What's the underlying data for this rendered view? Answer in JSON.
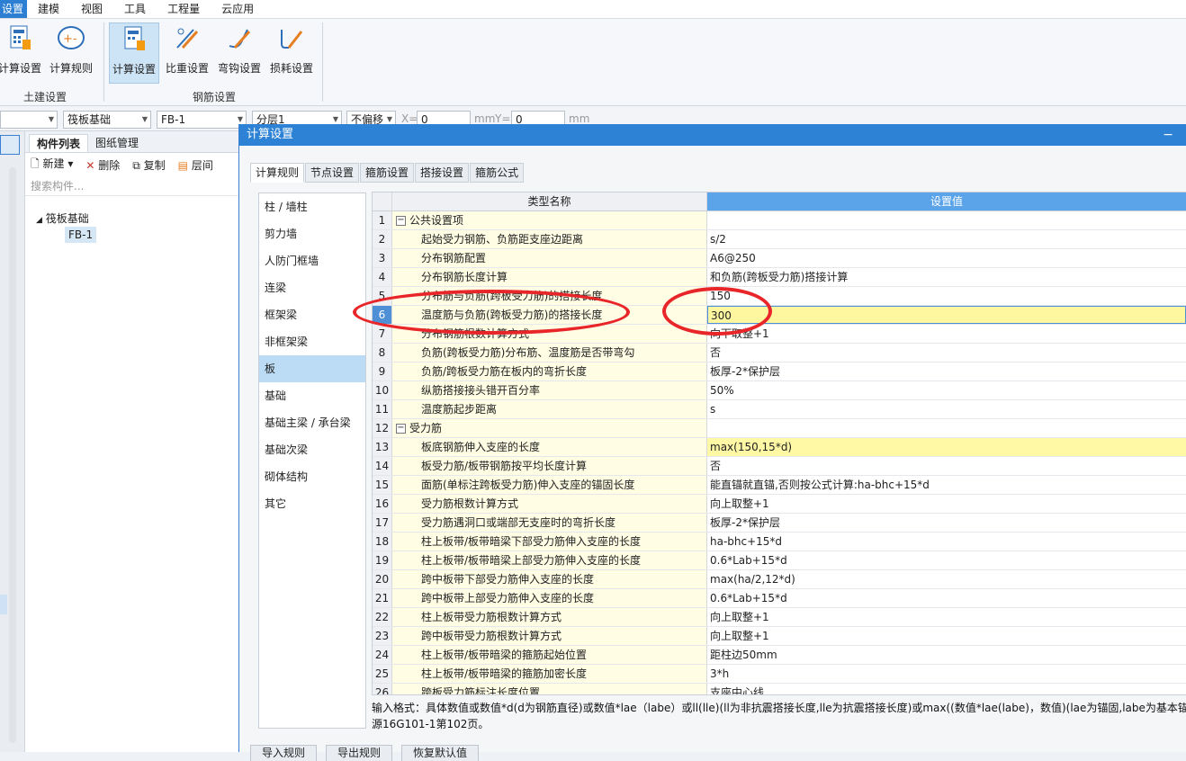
{
  "menubar": {
    "items": [
      "设置",
      "建模",
      "视图",
      "工具",
      "工程量",
      "云应用"
    ]
  },
  "ribbon": {
    "buttons": [
      "计算设置",
      "计算规则",
      "计算设置",
      "比重设置",
      "弯钩设置",
      "损耗设置"
    ],
    "groups": [
      "土建设置",
      "钢筋设置"
    ]
  },
  "toolbar2": {
    "combo_type": "筏板基础",
    "combo_name": "FB-1",
    "combo_layer": "分层1",
    "combo_offset": "不偏移",
    "x_label": "X=",
    "x_value": "0",
    "y_label": "Y=",
    "y_value": "0",
    "unit": "mm"
  },
  "left_panel": {
    "tabs": [
      "构件列表",
      "图纸管理"
    ],
    "tools": [
      "新建",
      "删除",
      "复制",
      "层间"
    ],
    "search_placeholder": "搜索构件...",
    "tree_root": "筏板基础",
    "tree_child": "FB-1"
  },
  "dialog": {
    "title": "计算设置",
    "tabs": [
      "计算规则",
      "节点设置",
      "箍筋设置",
      "搭接设置",
      "箍筋公式"
    ],
    "categories": [
      "柱 / 墙柱",
      "剪力墙",
      "人防门框墙",
      "连梁",
      "框架梁",
      "非框架梁",
      "板",
      "基础",
      "基础主梁 / 承台梁",
      "基础次梁",
      "砌体结构",
      "其它"
    ],
    "grid_headers": [
      "类型名称",
      "设置值"
    ],
    "rows": [
      {
        "n": "1",
        "name": "公共设置项",
        "value": "",
        "group": true
      },
      {
        "n": "2",
        "name": "起始受力钢筋、负筋距支座边距离",
        "value": "s/2"
      },
      {
        "n": "3",
        "name": "分布钢筋配置",
        "value": "A6@250"
      },
      {
        "n": "4",
        "name": "分布钢筋长度计算",
        "value": "和负筋(跨板受力筋)搭接计算"
      },
      {
        "n": "5",
        "name": "分布筋与负筋(跨板受力筋)的搭接长度",
        "value": "150"
      },
      {
        "n": "6",
        "name": "温度筋与负筋(跨板受力筋)的搭接长度",
        "value": "300",
        "current": true
      },
      {
        "n": "7",
        "name": "分布钢筋根数计算方式",
        "value": "向下取整+1"
      },
      {
        "n": "8",
        "name": "负筋(跨板受力筋)分布筋、温度筋是否带弯勾",
        "value": "否"
      },
      {
        "n": "9",
        "name": "负筋/跨板受力筋在板内的弯折长度",
        "value": "板厚-2*保护层"
      },
      {
        "n": "10",
        "name": "纵筋搭接接头错开百分率",
        "value": "50%"
      },
      {
        "n": "11",
        "name": "温度筋起步距离",
        "value": "s"
      },
      {
        "n": "12",
        "name": "受力筋",
        "value": "",
        "group": true
      },
      {
        "n": "13",
        "name": "板底钢筋伸入支座的长度",
        "value": "max(150,15*d)",
        "hl": true
      },
      {
        "n": "14",
        "name": "板受力筋/板带钢筋按平均长度计算",
        "value": "否"
      },
      {
        "n": "15",
        "name": "面筋(单标注跨板受力筋)伸入支座的锚固长度",
        "value": "能直锚就直锚,否则按公式计算:ha-bhc+15*d"
      },
      {
        "n": "16",
        "name": "受力筋根数计算方式",
        "value": "向上取整+1"
      },
      {
        "n": "17",
        "name": "受力筋遇洞口或端部无支座时的弯折长度",
        "value": "板厚-2*保护层"
      },
      {
        "n": "18",
        "name": "柱上板带/板带暗梁下部受力筋伸入支座的长度",
        "value": "ha-bhc+15*d"
      },
      {
        "n": "19",
        "name": "柱上板带/板带暗梁上部受力筋伸入支座的长度",
        "value": "0.6*Lab+15*d"
      },
      {
        "n": "20",
        "name": "跨中板带下部受力筋伸入支座的长度",
        "value": "max(ha/2,12*d)"
      },
      {
        "n": "21",
        "name": "跨中板带上部受力筋伸入支座的长度",
        "value": "0.6*Lab+15*d"
      },
      {
        "n": "22",
        "name": "柱上板带受力筋根数计算方式",
        "value": "向上取整+1"
      },
      {
        "n": "23",
        "name": "跨中板带受力筋根数计算方式",
        "value": "向上取整+1"
      },
      {
        "n": "24",
        "name": "柱上板带/板带暗梁的箍筋起始位置",
        "value": "距柱边50mm"
      },
      {
        "n": "25",
        "name": "柱上板带/板带暗梁的箍筋加密长度",
        "value": "3*h"
      },
      {
        "n": "26",
        "name": "跨板受力筋标注长度位置",
        "value": "支座中心线"
      }
    ],
    "hint_line1": "输入格式：具体数值或数值*d(d为钢筋直径)或数值*lae（labe）或ll(lle)(ll为非抗震搭接长度,lle为抗震搭接长度)或max((数值*lae(labe)，数值)(lae为锚固,labe为基本锚固)。",
    "hint_line2": "源16G101-1第102页。",
    "bottom_buttons": [
      "导入规则",
      "导出规则",
      "恢复默认值"
    ]
  }
}
